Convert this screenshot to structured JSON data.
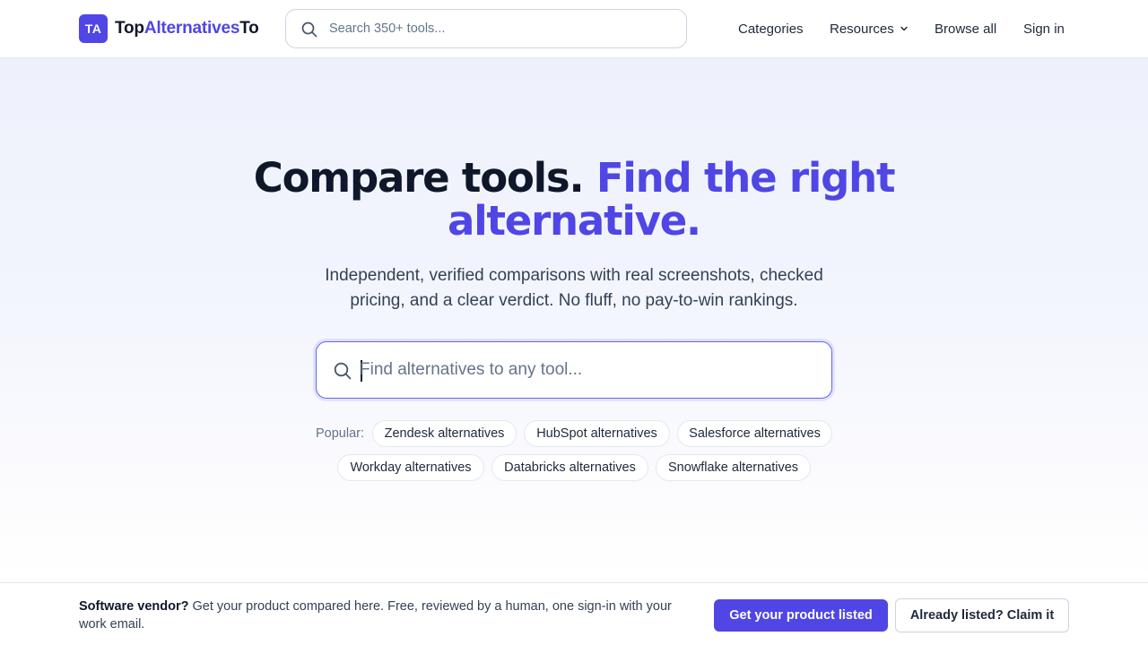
{
  "header": {
    "logo_badge": "TA",
    "logo_part1": "Top",
    "logo_part2": "Alternatives",
    "logo_part3": "To",
    "search_placeholder": "Search 350+ tools...",
    "nav": {
      "categories": "Categories",
      "resources": "Resources",
      "browse_all": "Browse all",
      "sign_in": "Sign in"
    }
  },
  "hero": {
    "headline_plain": "Compare tools.",
    "headline_accent": "Find the right alternative.",
    "subhead": "Independent, verified comparisons with real screenshots, checked pricing, and a clear verdict. No fluff, no pay-to-win rankings.",
    "search_placeholder": "Find alternatives to any tool...",
    "popular_label": "Popular:",
    "popular_chips": [
      "Zendesk alternatives",
      "HubSpot alternatives",
      "Salesforce alternatives",
      "Workday alternatives",
      "Databricks alternatives",
      "Snowflake alternatives"
    ]
  },
  "vendor_bar": {
    "lead": "Software vendor?",
    "text": " Get your product compared here. Free, reviewed by a human, one sign-in with your work email.",
    "primary_button": "Get your product listed",
    "secondary_button": "Already listed? Claim it"
  },
  "colors": {
    "brand": "#4f46e5",
    "text_dark": "#0f172a",
    "text_muted": "#64748b"
  },
  "icons": {
    "search": "search-icon",
    "chevron": "chevron-down-icon"
  }
}
